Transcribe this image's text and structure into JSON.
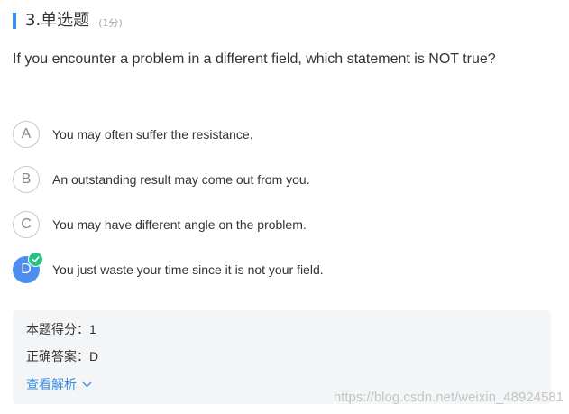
{
  "question": {
    "title": "3.单选题",
    "score": "(1分)",
    "text": "If you encounter a problem in a different field, which statement is NOT true?"
  },
  "options": [
    {
      "letter": "A",
      "text": "You may often suffer the resistance.",
      "selected": false
    },
    {
      "letter": "B",
      "text": "An outstanding result may come out from you.",
      "selected": false
    },
    {
      "letter": "C",
      "text": "You may have different angle on the problem.",
      "selected": false
    },
    {
      "letter": "D",
      "text": "You just waste your time since it is not your field.",
      "selected": true
    }
  ],
  "result": {
    "score_label": "本题得分：",
    "score_value": "1",
    "answer_label": "正确答案：",
    "answer_value": "D",
    "analysis_link": "查看解析"
  },
  "watermark": "https://blog.csdn.net/weixin_48924581",
  "colors": {
    "accent": "#3a8ee6",
    "selected_option": "#4d8ef0",
    "correct_badge": "#27c281",
    "answer_box_bg": "#f4f5f7"
  },
  "icons": {
    "correct_badge": "check-icon",
    "analysis_toggle": "chevron-down-icon"
  }
}
